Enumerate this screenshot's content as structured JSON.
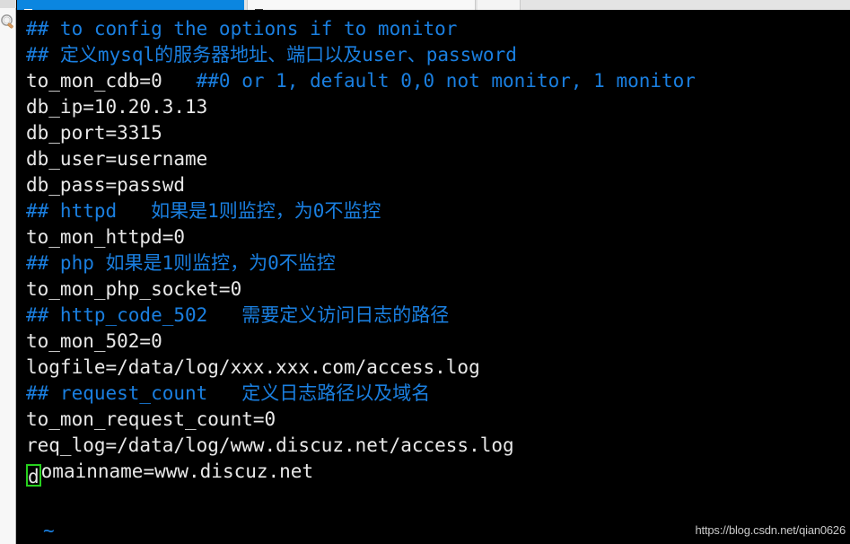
{
  "window": {
    "tabs": [
      {
        "label": "",
        "icon": "terminal-icon",
        "active": true
      },
      {
        "label": "",
        "icon": "terminal-icon",
        "active": false
      }
    ]
  },
  "sidebar": {
    "icons": [
      {
        "name": "search-icon",
        "label": ""
      }
    ]
  },
  "colors": {
    "background": "#000000",
    "comment": "#1a7fe0",
    "text": "#e8e8e8",
    "cursor": "#27d11e",
    "tab_active": "#0b86e0",
    "watermark": "#c9c9c9"
  },
  "editor": {
    "cursor_char": "d",
    "tilde": "~",
    "lines": [
      {
        "segments": [
          {
            "type": "comment",
            "text": "## to config the options if to monitor"
          }
        ]
      },
      {
        "segments": [
          {
            "type": "comment",
            "text": "## 定义mysql的服务器地址、端口以及user、password"
          }
        ]
      },
      {
        "segments": [
          {
            "type": "text",
            "text": "to_mon_cdb=0"
          },
          {
            "type": "comment",
            "text": "   ##0 or 1, default 0,0 not monitor, 1 monitor"
          }
        ]
      },
      {
        "segments": [
          {
            "type": "text",
            "text": "db_ip=10.20.3.13"
          }
        ]
      },
      {
        "segments": [
          {
            "type": "text",
            "text": "db_port=3315"
          }
        ]
      },
      {
        "segments": [
          {
            "type": "text",
            "text": "db_user=username"
          }
        ]
      },
      {
        "segments": [
          {
            "type": "text",
            "text": "db_pass=passwd"
          }
        ]
      },
      {
        "segments": [
          {
            "type": "comment",
            "text": "## httpd   如果是1则监控，为0不监控"
          }
        ]
      },
      {
        "segments": [
          {
            "type": "text",
            "text": "to_mon_httpd=0"
          }
        ]
      },
      {
        "segments": [
          {
            "type": "comment",
            "text": "## php 如果是1则监控，为0不监控"
          }
        ]
      },
      {
        "segments": [
          {
            "type": "text",
            "text": "to_mon_php_socket=0"
          }
        ]
      },
      {
        "segments": [
          {
            "type": "comment",
            "text": "## http_code_502   需要定义访问日志的路径"
          }
        ]
      },
      {
        "segments": [
          {
            "type": "text",
            "text": "to_mon_502=0"
          }
        ]
      },
      {
        "segments": [
          {
            "type": "text",
            "text": "logfile=/data/log/xxx.xxx.com/access.log"
          }
        ]
      },
      {
        "segments": [
          {
            "type": "comment",
            "text": "## request_count   定义日志路径以及域名"
          }
        ]
      },
      {
        "segments": [
          {
            "type": "text",
            "text": "to_mon_request_count=0"
          }
        ]
      },
      {
        "segments": [
          {
            "type": "text",
            "text": "req_log=/data/log/www.discuz.net/access.log"
          }
        ]
      },
      {
        "segments": [
          {
            "type": "text",
            "text": "omainname=www.discuz.net",
            "cursor": true
          }
        ]
      }
    ]
  },
  "watermark": {
    "text": "https://blog.csdn.net/qian0626"
  }
}
